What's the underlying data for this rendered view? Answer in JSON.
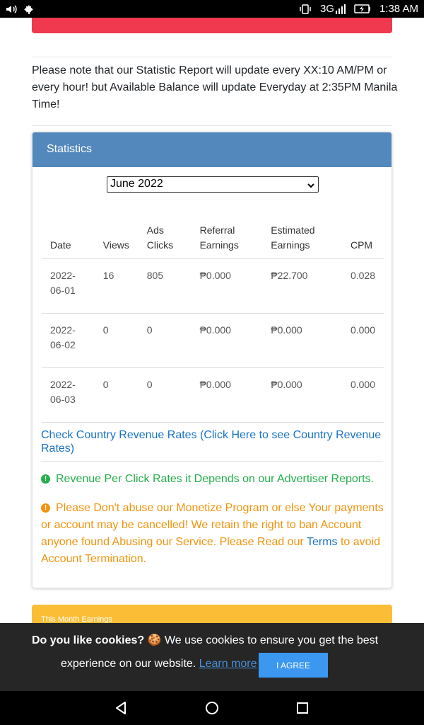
{
  "status_bar": {
    "time": "1:38 AM",
    "network": "3G",
    "icons": [
      "volume-icon",
      "maple-leaf-icon",
      "vibrate-icon",
      "signal-icon",
      "battery-charging-icon"
    ]
  },
  "notice": "Please note that our Statistic Report will update every XX:10 AM/PM or every hour! but Available Balance will update Everyday at 2:35PM Manila Time!",
  "statistics": {
    "title": "Statistics",
    "month_select": "June 2022",
    "columns": [
      "Date",
      "Views",
      "Ads Clicks",
      "Referral Earnings",
      "Estimated Earnings",
      "CPM"
    ],
    "rows": [
      {
        "date": "2022-06-01",
        "views": "16",
        "ads_clicks": "805",
        "referral": "₱0.000",
        "estimated": "₱22.700",
        "cpm": "0.028"
      },
      {
        "date": "2022-06-02",
        "views": "0",
        "ads_clicks": "0",
        "referral": "₱0.000",
        "estimated": "₱0.000",
        "cpm": "0.000"
      },
      {
        "date": "2022-06-03",
        "views": "0",
        "ads_clicks": "0",
        "referral": "₱0.000",
        "estimated": "₱0.000",
        "cpm": "0.000"
      }
    ],
    "country_link": "Check Country Revenue Rates (Click Here to see Country Revenue Rates)",
    "green_msg": "Revenue Per Click Rates it Depends on our Advertiser Reports.",
    "orange_msg_before": "Please Don't abuse our Monetize Program or else Your payments or account may be cancelled! We retain the right to ban Account anyone found Abusing our Service. Please Read our ",
    "terms_link": "Terms",
    "orange_msg_after": " to avoid Account Termination."
  },
  "next_card_title": "This Month Earnings",
  "cookie_banner": {
    "question": "Do you like cookies?",
    "emoji": "🍪",
    "text1": "We use cookies to ensure you get the best",
    "text2": "experience on our website.",
    "learn_more": "Learn more",
    "agree": "I AGREE"
  },
  "colors": {
    "header_blue": "#5288bb",
    "alert_red": "#f0384f",
    "success_green": "#23b04a",
    "warning_orange": "#f0940f",
    "earnings_yellow": "#fbbd35",
    "agree_blue": "#3b97f0"
  }
}
